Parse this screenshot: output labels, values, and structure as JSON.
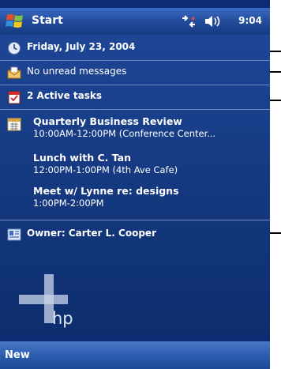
{
  "taskbar": {
    "start_label": "Start",
    "time": "9:04"
  },
  "date": {
    "label": "Friday, July 23, 2004"
  },
  "messages": {
    "label": "No unread messages"
  },
  "tasks": {
    "label": "2 Active tasks"
  },
  "calendar": {
    "appointments": [
      {
        "title": "Quarterly Business Review",
        "details": "10:00AM-12:00PM (Conference Center..."
      },
      {
        "title": "Lunch with C. Tan",
        "details": "12:00PM-1:00PM (4th Ave Cafe)"
      },
      {
        "title": "Meet w/ Lynne re: designs",
        "details": "1:00PM-2:00PM"
      }
    ]
  },
  "owner": {
    "label": "Owner: Carter L. Cooper"
  },
  "brand": {
    "hp": "hp"
  },
  "menu": {
    "new_label": "New"
  }
}
